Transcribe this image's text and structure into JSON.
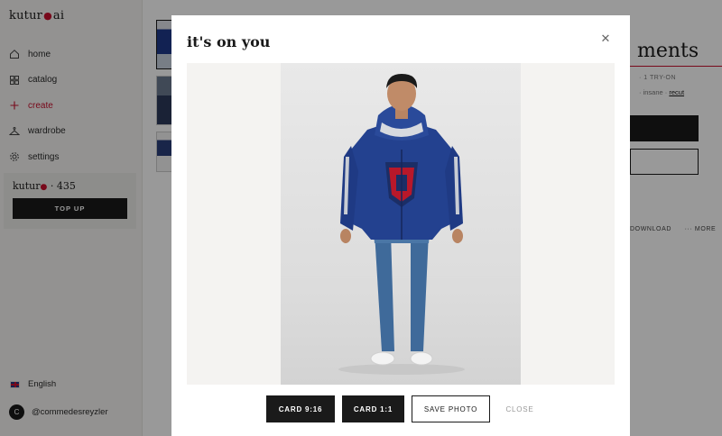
{
  "app": {
    "brand": {
      "left": "kutur",
      "right": "ai"
    },
    "nav": [
      {
        "label": "home",
        "icon": "home-icon"
      },
      {
        "label": "catalog",
        "icon": "grid-icon"
      },
      {
        "label": "create",
        "icon": "plus-icon",
        "active": true
      },
      {
        "label": "wardrobe",
        "icon": "hanger-icon"
      },
      {
        "label": "settings",
        "icon": "gear-icon"
      }
    ],
    "credits": {
      "brand": "kutur",
      "count": "435",
      "topup_label": "TOP UP"
    },
    "language": "English",
    "user": {
      "avatar_letter": "C",
      "handle": "@commedesreyzler"
    }
  },
  "background_panel": {
    "title": "ments",
    "meta": "· 1 TRY-ON",
    "tags": "· insane ·",
    "tag_link": "recut",
    "actions": [
      "DOWNLOAD",
      "··· MORE"
    ]
  },
  "modal": {
    "title": "it's on you",
    "close_icon": "close-icon",
    "buttons": {
      "card_916": "CARD 9:16",
      "card_11": "CARD 1:1",
      "save_photo": "SAVE PHOTO",
      "close": "CLOSE"
    }
  },
  "colors": {
    "accent": "#c8102e",
    "primary_button": "#1a1a1a",
    "sidebar_bg": "#f5f4f2"
  }
}
